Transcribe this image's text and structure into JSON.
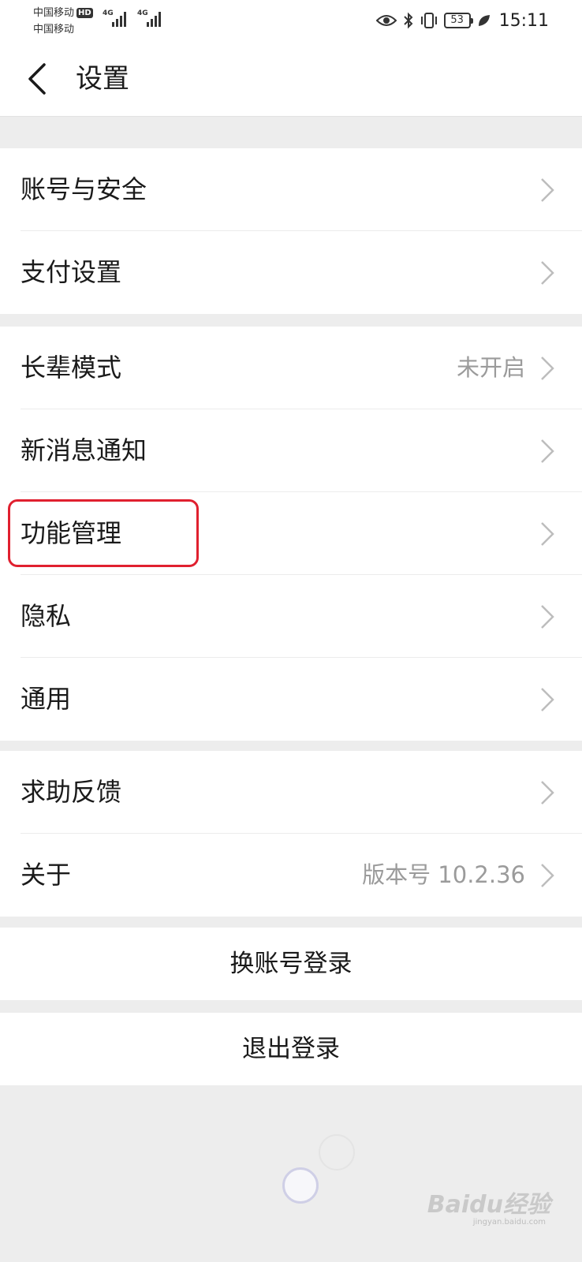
{
  "status_bar": {
    "carrier_1": "中国移动",
    "carrier_1_badge": "HD",
    "carrier_2": "中国移动",
    "network_1": "4G",
    "network_2": "4G",
    "battery": "53",
    "time": "15:11"
  },
  "nav": {
    "title": "设置"
  },
  "groups": [
    {
      "items": [
        {
          "label": "账号与安全",
          "value": ""
        },
        {
          "label": "支付设置",
          "value": ""
        }
      ]
    },
    {
      "items": [
        {
          "label": "长辈模式",
          "value": "未开启"
        },
        {
          "label": "新消息通知",
          "value": ""
        },
        {
          "label": "功能管理",
          "value": ""
        },
        {
          "label": "隐私",
          "value": ""
        },
        {
          "label": "通用",
          "value": ""
        }
      ]
    },
    {
      "items": [
        {
          "label": "求助反馈",
          "value": ""
        },
        {
          "label": "关于",
          "value": "版本号 10.2.36"
        }
      ]
    }
  ],
  "actions": {
    "switch_account": "换账号登录",
    "logout": "退出登录"
  },
  "highlight": {
    "target": "功能管理",
    "color": "#E0202F"
  },
  "watermark": {
    "text": "Baidu经验",
    "sub": "jingyan.baidu.com"
  },
  "icons": {
    "back": "chevron-left-icon",
    "row_arrow": "chevron-right-icon",
    "eye": "eye-icon",
    "bluetooth": "bluetooth-icon",
    "vibrate": "vibrate-icon",
    "leaf": "leaf-icon"
  }
}
